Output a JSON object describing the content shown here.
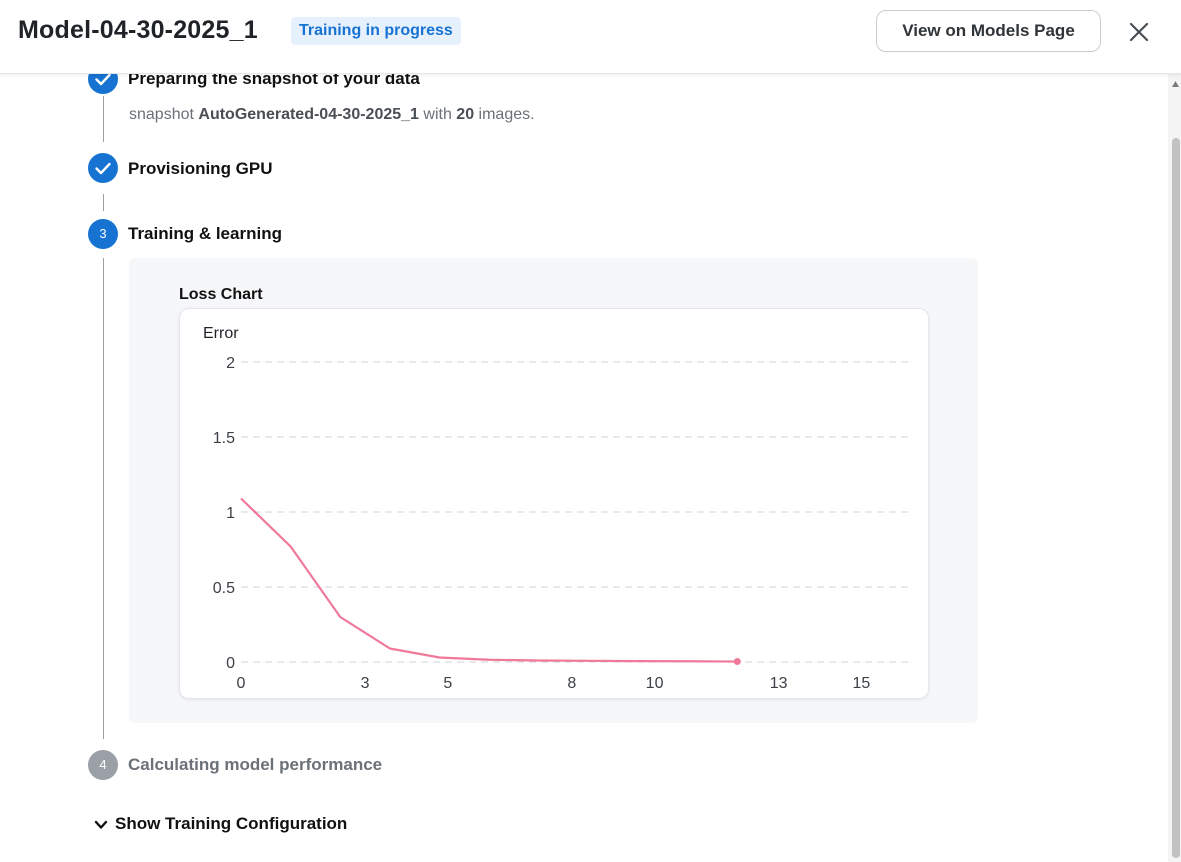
{
  "header": {
    "title": "Model-04-30-2025_1",
    "status": "Training in progress",
    "view_button": "View on Models Page",
    "close_icon": "close-icon"
  },
  "steps": [
    {
      "label": "Preparing the snapshot of your data",
      "state": "done"
    },
    {
      "label": "Provisioning GPU",
      "state": "done"
    },
    {
      "number": "3",
      "label": "Training & learning",
      "state": "active"
    },
    {
      "number": "4",
      "label": "Calculating model performance",
      "state": "pending"
    }
  ],
  "snapshot": {
    "prefix": "snapshot",
    "name": "AutoGenerated-04-30-2025_1",
    "middle": "with",
    "count": "20",
    "suffix": "images."
  },
  "chart": {
    "title": "Loss Chart"
  },
  "chart_data": {
    "type": "line",
    "ylabel": "Error",
    "xlabel": "",
    "x_ticks": [
      "0",
      "3",
      "5",
      "8",
      "10",
      "13",
      "15"
    ],
    "y_ticks": [
      "0",
      "0.5",
      "1",
      "1.5",
      "2"
    ],
    "xlim": [
      0,
      16.2
    ],
    "ylim": [
      0,
      2
    ],
    "grid": true,
    "line_color": "#f0799a",
    "series": [
      {
        "x": [
          0,
          1.2,
          2.4,
          3.6,
          4.8,
          6.0,
          7.2,
          8.4,
          9.6,
          10.8,
          12.0
        ],
        "y": [
          1.09,
          0.77,
          0.3,
          0.09,
          0.03,
          0.015,
          0.01,
          0.008,
          0.006,
          0.005,
          0.003
        ]
      }
    ]
  },
  "config_toggle": "Show Training Configuration",
  "colors": {
    "accent": "#1673d1",
    "badge_bg": "#e6f1fd",
    "pending": "#9aa0a6"
  }
}
